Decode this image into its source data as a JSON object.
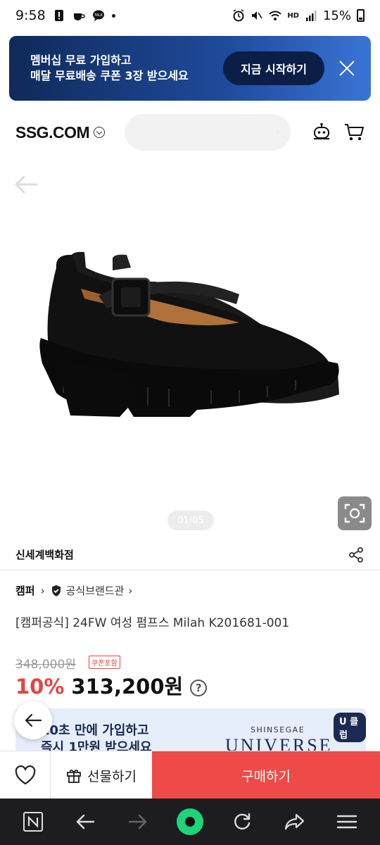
{
  "status": {
    "time": "9:58",
    "battery": "15%",
    "network": "HD"
  },
  "promo": {
    "line1": "멤버십 무료 가입하고",
    "line2": "매달 무료배송 쿠폰 3장 받으세요",
    "cta": "지금 시작하기"
  },
  "header": {
    "logo": "SSG.COM",
    "search_placeholder": ""
  },
  "pager": "01/05",
  "seller": {
    "name": "신세계백화점"
  },
  "brand": {
    "name": "캠퍼",
    "official": "공식브랜드관"
  },
  "product": {
    "title": "[캠퍼공식] 24FW 여성 펌프스 Milah K201681-001",
    "original_price": "348,000원",
    "coupon_badge": "쿠폰포함",
    "discount": "10%",
    "price": "313,200원"
  },
  "universe_banner": {
    "text_line1": "10초 만에 가입하고",
    "text_line2": "즉시 1만원 받으세요",
    "brand_top": "SHINSEGAE",
    "brand_main": "UNIVERSE",
    "club": "U 클럽"
  },
  "bottom_bar": {
    "gift": "선물하기",
    "buy": "구매하기"
  },
  "colors": {
    "accent": "#ee4b48",
    "promo_bg": "#1f4b9c",
    "nav_bg": "#1d1d1f"
  }
}
